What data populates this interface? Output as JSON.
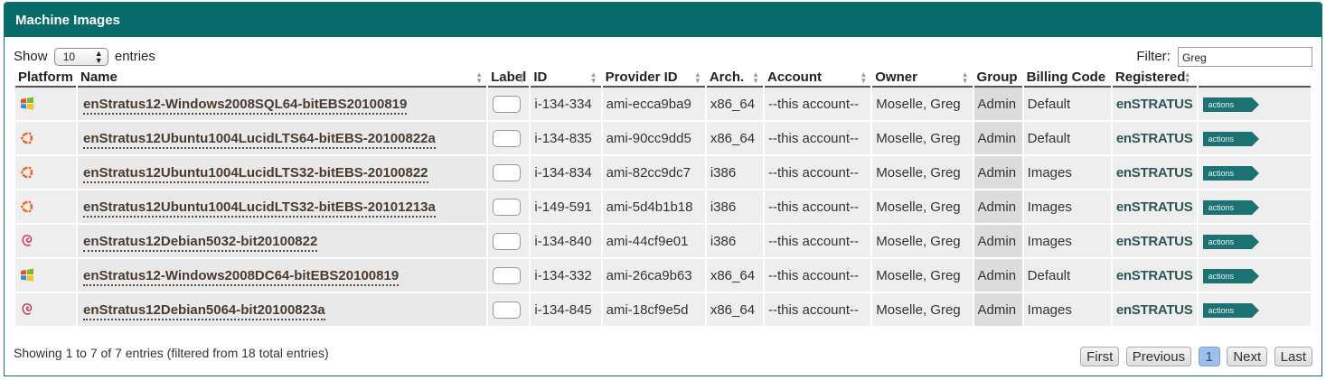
{
  "panel": {
    "title": "Machine Images"
  },
  "length_control": {
    "show_label": "Show",
    "value": "10",
    "entries_label": "entries"
  },
  "filter": {
    "label": "Filter:",
    "value": "Greg"
  },
  "columns": {
    "platform": "Platform",
    "name": "Name",
    "label": "Label",
    "id": "ID",
    "provider_id": "Provider ID",
    "arch": "Arch.",
    "account": "Account",
    "owner": "Owner",
    "group": "Group",
    "billing_code": "Billing Code",
    "registered": "Registered"
  },
  "rows": [
    {
      "platform": "windows",
      "name": "enStratus12-Windows2008SQL64-bitEBS20100819",
      "id": "i-134-334",
      "provider_id": "ami-ecca9ba9",
      "arch": "x86_64",
      "account": "--this account--",
      "owner": "Moselle, Greg",
      "group": "Admin",
      "billing": "Default",
      "registered": "enSTRATUS",
      "action": "actions"
    },
    {
      "platform": "ubuntu",
      "name": "enStratus12Ubuntu1004LucidLTS64-bitEBS-20100822a",
      "id": "i-134-835",
      "provider_id": "ami-90cc9dd5",
      "arch": "x86_64",
      "account": "--this account--",
      "owner": "Moselle, Greg",
      "group": "Admin",
      "billing": "Default",
      "registered": "enSTRATUS",
      "action": "actions"
    },
    {
      "platform": "ubuntu",
      "name": "enStratus12Ubuntu1004LucidLTS32-bitEBS-20100822",
      "id": "i-134-834",
      "provider_id": "ami-82cc9dc7",
      "arch": "i386",
      "account": "--this account--",
      "owner": "Moselle, Greg",
      "group": "Admin",
      "billing": "Images",
      "registered": "enSTRATUS",
      "action": "actions"
    },
    {
      "platform": "ubuntu",
      "name": "enStratus12Ubuntu1004LucidLTS32-bitEBS-20101213a",
      "id": "i-149-591",
      "provider_id": "ami-5d4b1b18",
      "arch": "i386",
      "account": "--this account--",
      "owner": "Moselle, Greg",
      "group": "Admin",
      "billing": "Images",
      "registered": "enSTRATUS",
      "action": "actions"
    },
    {
      "platform": "debian",
      "name": "enStratus12Debian5032-bit20100822",
      "id": "i-134-840",
      "provider_id": "ami-44cf9e01",
      "arch": "i386",
      "account": "--this account--",
      "owner": "Moselle, Greg",
      "group": "Admin",
      "billing": "Images",
      "registered": "enSTRATUS",
      "action": "actions"
    },
    {
      "platform": "windows",
      "name": "enStratus12-Windows2008DC64-bitEBS20100819",
      "id": "i-134-332",
      "provider_id": "ami-26ca9b63",
      "arch": "x86_64",
      "account": "--this account--",
      "owner": "Moselle, Greg",
      "group": "Admin",
      "billing": "Default",
      "registered": "enSTRATUS",
      "action": "actions"
    },
    {
      "platform": "debian",
      "name": "enStratus12Debian5064-bit20100823a",
      "id": "i-134-845",
      "provider_id": "ami-18cf9e5d",
      "arch": "x86_64",
      "account": "--this account--",
      "owner": "Moselle, Greg",
      "group": "Admin",
      "billing": "Images",
      "registered": "enSTRATUS",
      "action": "actions"
    }
  ],
  "footer": {
    "info": "Showing 1 to 7 of 7 entries (filtered from 18 total entries)"
  },
  "pagination": {
    "first": "First",
    "previous": "Previous",
    "current": "1",
    "next": "Next",
    "last": "Last"
  },
  "colors": {
    "header_bg": "#086b6b",
    "accent": "#1c7272",
    "link": "#4a3b2e",
    "current_page": "#9ec0ea"
  }
}
